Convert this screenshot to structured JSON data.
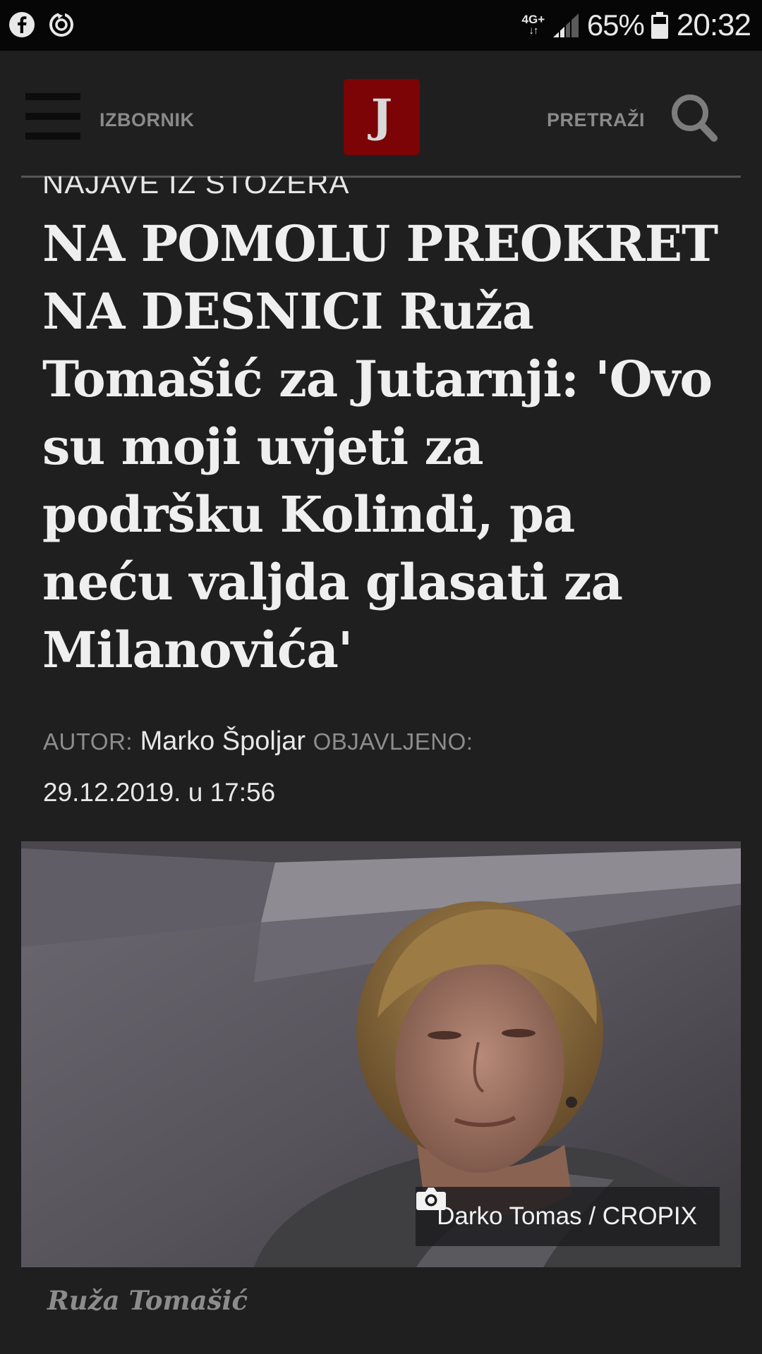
{
  "status_bar": {
    "network": "4G+",
    "battery_percent": "65%",
    "time": "20:32",
    "left_icons": [
      "facebook-icon",
      "sync-icon"
    ]
  },
  "header": {
    "menu_label": "IZBORNIK",
    "logo_letter": "J",
    "search_label": "PRETRAŽI",
    "logo_color": "#7c0406"
  },
  "article": {
    "kicker": "NAJAVE IZ STOŽERA",
    "headline": "NA POMOLU PREOKRET NA DESNICI Ruža Tomašić za Jutarnji: 'Ovo su moji uvjeti za podršku Kolindi, pa neću valjda glasati za Milanovića'",
    "author_label": "AUTOR:",
    "author": "Marko Špoljar",
    "published_label": "OBJAVLJENO:",
    "published": "29.12.2019. u 17:56",
    "photo_credit": "Darko Tomas / CROPIX",
    "photo_caption": "Ruža Tomašić"
  }
}
